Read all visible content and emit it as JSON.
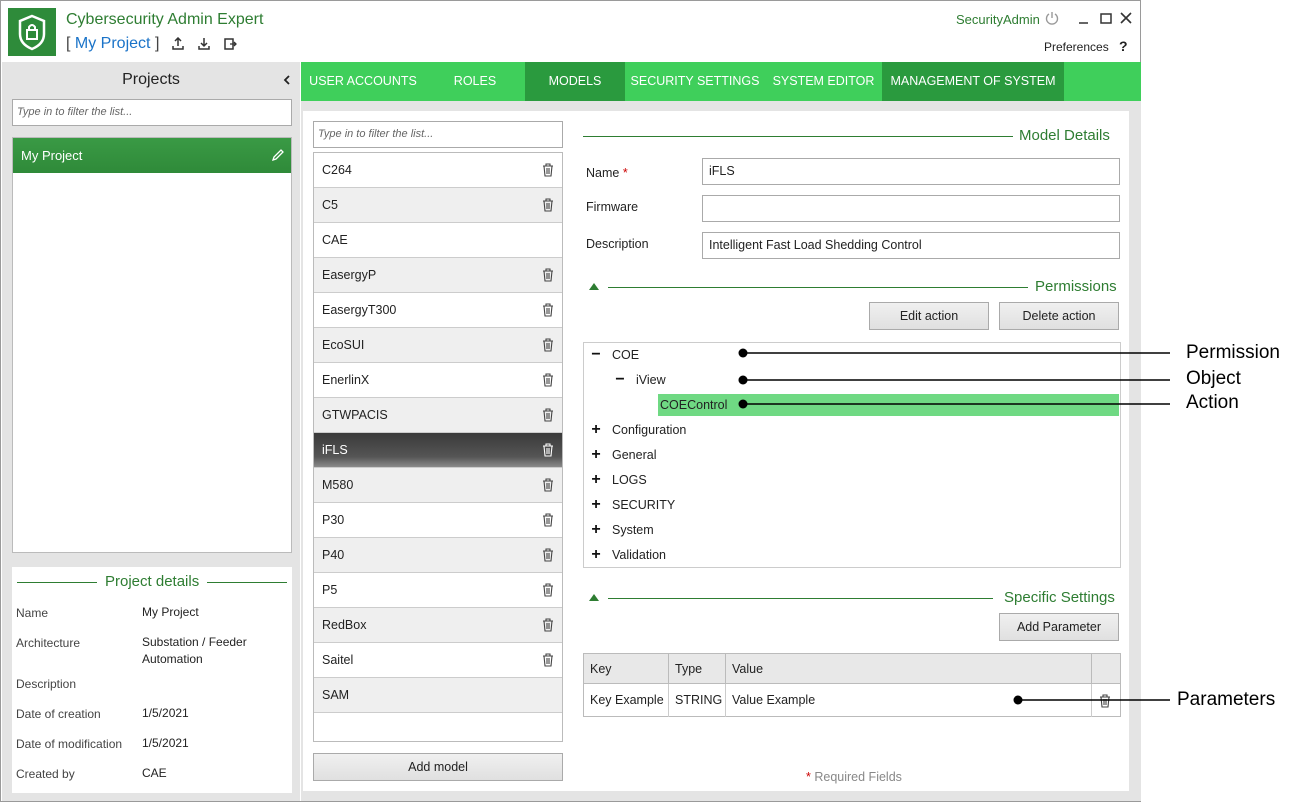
{
  "app": {
    "title": "Cybersecurity Admin Expert",
    "project_prefix": "[",
    "project_name": "My Project",
    "project_suffix": "]",
    "user": "SecurityAdmin",
    "preferences": "Preferences",
    "help": "?"
  },
  "projects": {
    "header": "Projects",
    "filter_placeholder": "Type in to filter the list...",
    "items": [
      {
        "label": "My Project"
      }
    ]
  },
  "project_details": {
    "title": "Project details",
    "fields": [
      {
        "label": "Name",
        "value": "My Project"
      },
      {
        "label": "Architecture",
        "value": "Substation / Feeder Automation"
      },
      {
        "label": "Description",
        "value": ""
      },
      {
        "label": "Date of creation",
        "value": "1/5/2021"
      },
      {
        "label": "Date of modification",
        "value": "1/5/2021"
      },
      {
        "label": "Created by",
        "value": "CAE"
      }
    ]
  },
  "nav": {
    "tabs": [
      {
        "label": "USER ACCOUNTS"
      },
      {
        "label": "ROLES"
      },
      {
        "label": "MODELS",
        "active": true
      },
      {
        "label": "SECURITY SETTINGS"
      },
      {
        "label": "SYSTEM EDITOR"
      },
      {
        "label": "MANAGEMENT OF SYSTEM"
      }
    ]
  },
  "models": {
    "filter_placeholder": "Type in to filter the list...",
    "items": [
      {
        "label": "C264",
        "deletable": true
      },
      {
        "label": "C5",
        "deletable": true
      },
      {
        "label": "CAE",
        "deletable": false
      },
      {
        "label": "EasergyP",
        "deletable": true
      },
      {
        "label": "EasergyT300",
        "deletable": true
      },
      {
        "label": "EcoSUI",
        "deletable": true
      },
      {
        "label": "EnerlinX",
        "deletable": true
      },
      {
        "label": "GTWPACIS",
        "deletable": true
      },
      {
        "label": "iFLS",
        "deletable": true,
        "selected": true
      },
      {
        "label": "M580",
        "deletable": true
      },
      {
        "label": "P30",
        "deletable": true
      },
      {
        "label": "P40",
        "deletable": true
      },
      {
        "label": "P5",
        "deletable": true
      },
      {
        "label": "RedBox",
        "deletable": true
      },
      {
        "label": "Saitel",
        "deletable": true
      },
      {
        "label": "SAM",
        "deletable": false
      }
    ],
    "add_label": "Add model"
  },
  "model_details": {
    "title": "Model Details",
    "name_label": "Name",
    "required_mark": "*",
    "name_value": "iFLS",
    "firmware_label": "Firmware",
    "firmware_value": "",
    "description_label": "Description",
    "description_value": "Intelligent Fast Load Shedding Control"
  },
  "permissions": {
    "title": "Permissions",
    "edit_label": "Edit action",
    "delete_label": "Delete action",
    "tree": [
      {
        "sign": "−",
        "label": "COE"
      },
      {
        "sign": "−",
        "label": "iView"
      },
      {
        "sign": "",
        "label": "COEControl",
        "selected": true
      },
      {
        "sign": "+",
        "label": "Configuration"
      },
      {
        "sign": "+",
        "label": "General"
      },
      {
        "sign": "+",
        "label": "LOGS"
      },
      {
        "sign": "+",
        "label": "SECURITY"
      },
      {
        "sign": "+",
        "label": "System"
      },
      {
        "sign": "+",
        "label": "Validation"
      }
    ]
  },
  "specific_settings": {
    "title": "Specific Settings",
    "add_label": "Add Parameter",
    "columns": [
      "Key",
      "Type",
      "Value"
    ],
    "rows": [
      {
        "key": "Key Example",
        "type": "STRING",
        "value": "Value Example"
      }
    ]
  },
  "footer": {
    "required_mark": "*",
    "required_text": "Required Fields"
  },
  "callouts": {
    "permission": "Permission",
    "object": "Object",
    "action": "Action",
    "parameters": "Parameters"
  },
  "colors": {
    "brand_green": "#3fcf5b",
    "active_tab": "#2a9a3e",
    "header_green": "#2e7d32",
    "selection_green": "#6fd983"
  }
}
